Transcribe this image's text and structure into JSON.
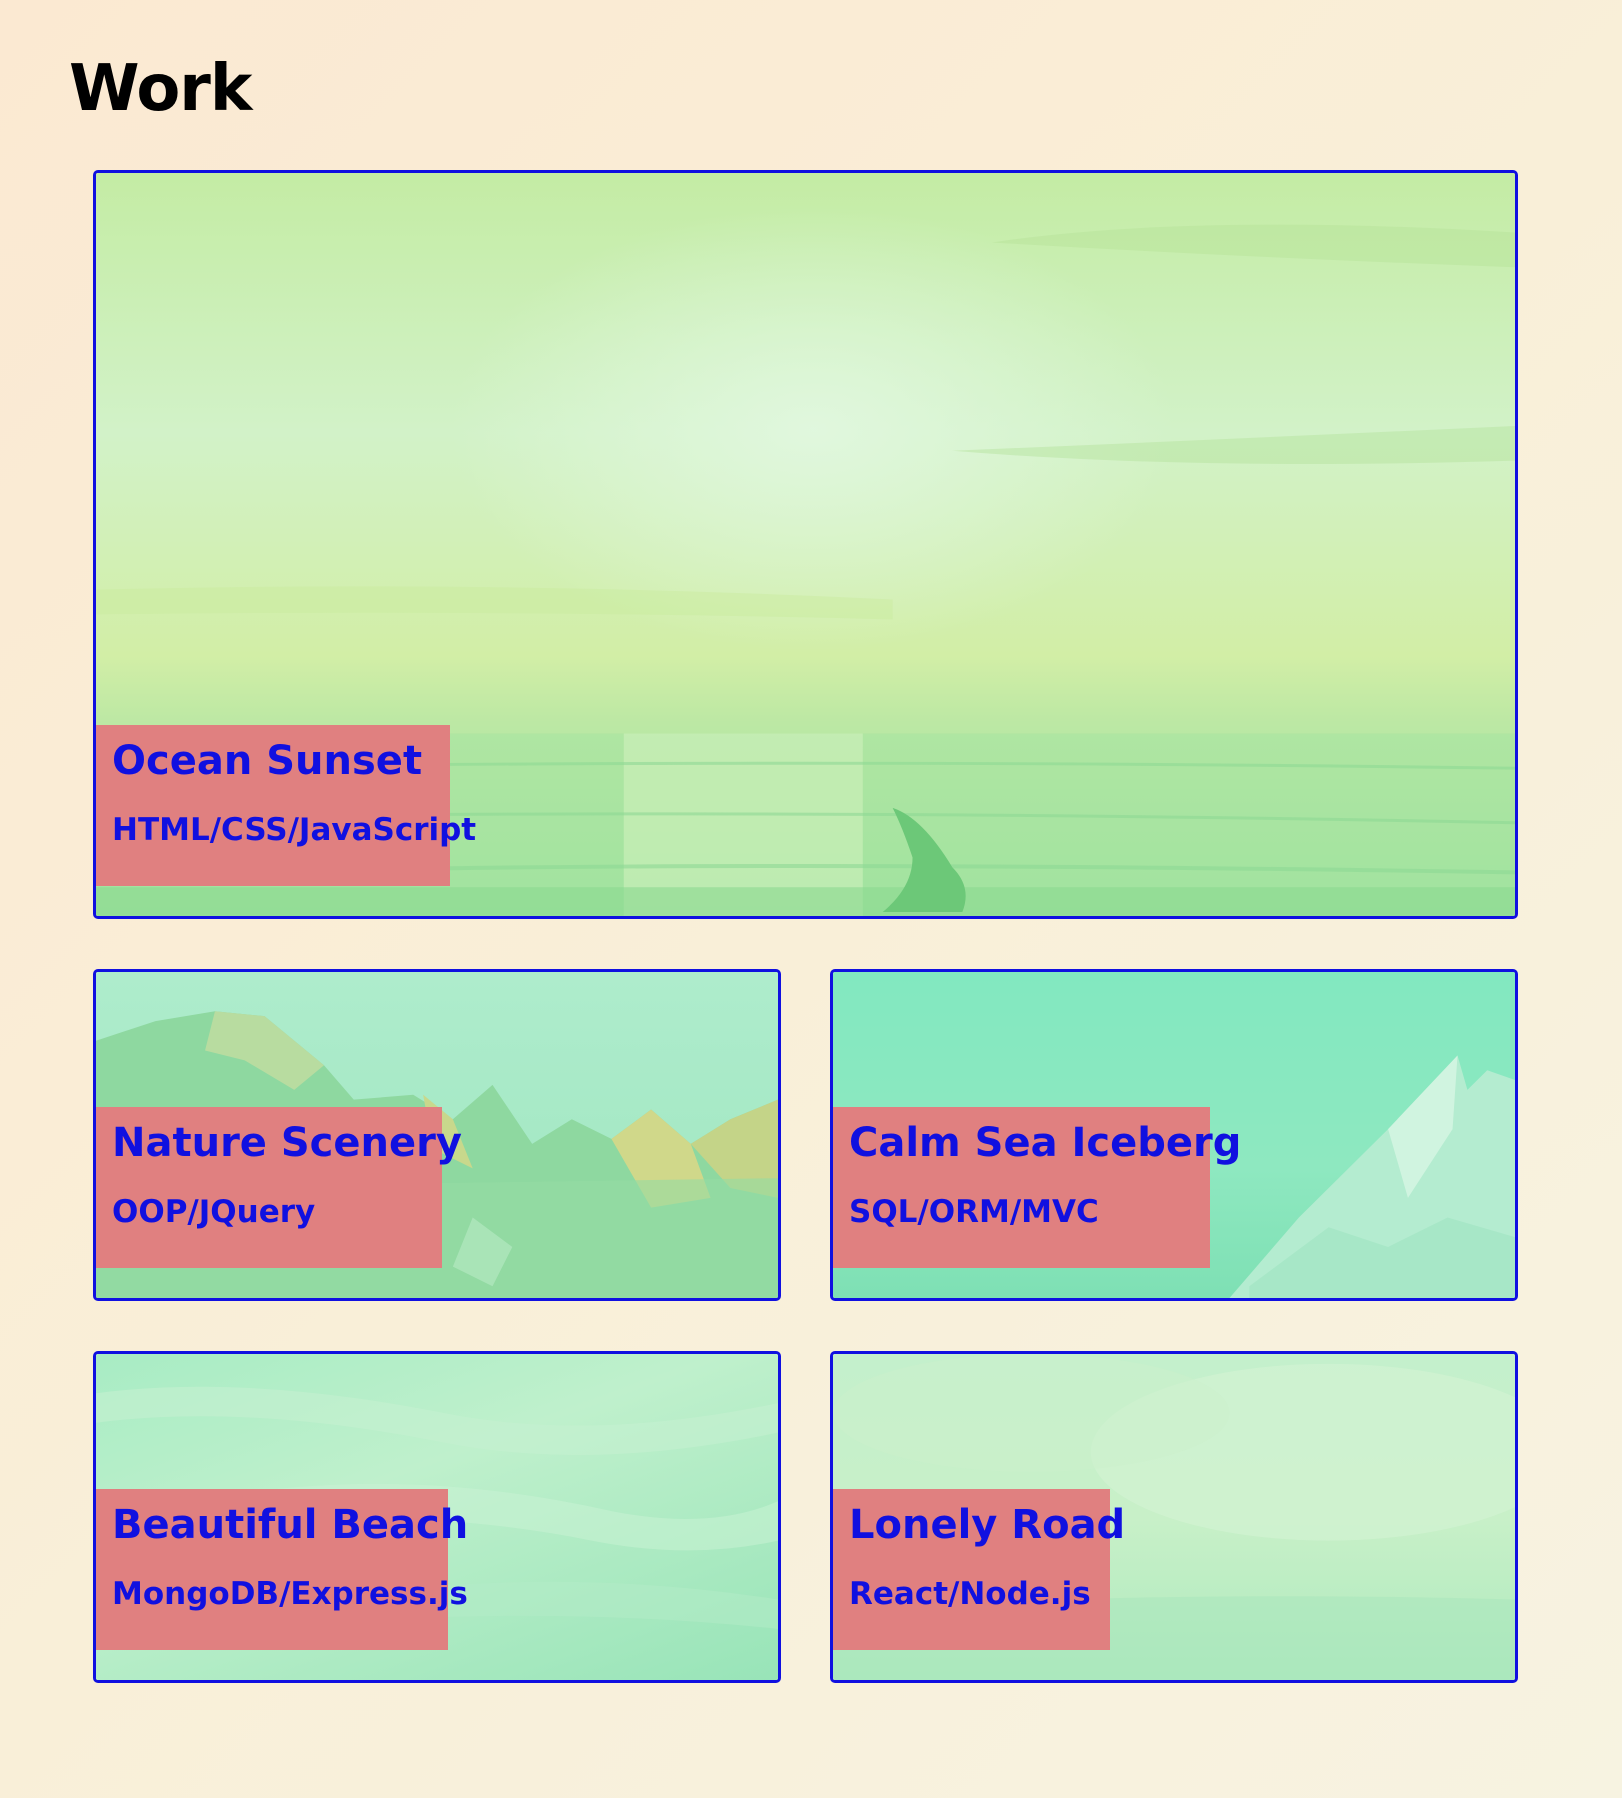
{
  "section": {
    "title": "Work"
  },
  "projects": [
    {
      "title": "Ocean Sunset",
      "tech": "HTML/CSS/JavaScript"
    },
    {
      "title": "Nature Scenery",
      "tech": "OOP/JQuery"
    },
    {
      "title": "Calm Sea Iceberg",
      "tech": "SQL/ORM/MVC"
    },
    {
      "title": "Beautiful Beach",
      "tech": "MongoDB/Express.js"
    },
    {
      "title": "Lonely Road",
      "tech": "React/Node.js"
    }
  ],
  "colors": {
    "border": "#1010e0",
    "label_bg": "#e08080",
    "label_text": "#1010e0"
  }
}
